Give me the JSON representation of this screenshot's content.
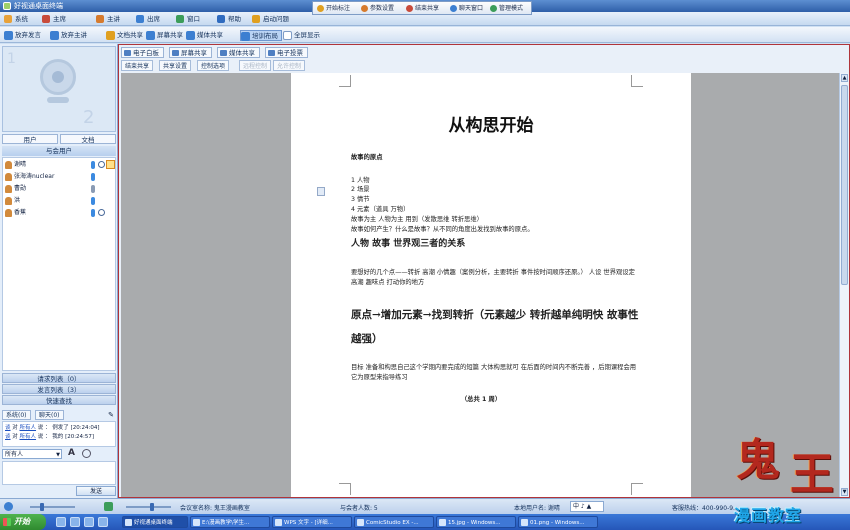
{
  "app": {
    "title": "好视通桌面终端"
  },
  "menu": [
    {
      "label": "系统",
      "color": "#e8a23a"
    },
    {
      "label": "主席",
      "color": "#c84b3b"
    },
    {
      "label": "主讲",
      "color": "#d67b2e"
    },
    {
      "label": "出席",
      "color": "#3c7fd1"
    },
    {
      "label": "窗口",
      "color": "#3c9d5a"
    },
    {
      "label": "帮助",
      "color": "#2f6bbf"
    },
    {
      "label": "启动问题",
      "color": "#e0a020"
    }
  ],
  "floatbar": [
    {
      "label": "开始标注",
      "color": "#e0a020"
    },
    {
      "label": "参数设置",
      "color": "#d67b2e"
    },
    {
      "label": "结束共享",
      "color": "#c84b3b"
    },
    {
      "label": "聊天窗口",
      "color": "#3c7fd1"
    },
    {
      "label": "管理模式",
      "color": "#3c9d5a"
    }
  ],
  "toolbar": [
    {
      "label": "放弃发言",
      "color": "#3c7fd1"
    },
    {
      "label": "放弃主讲",
      "color": "#3c7fd1"
    },
    {
      "label": "文档共享",
      "color": "#e0a020"
    },
    {
      "label": "屏幕共享",
      "color": "#3c7fd1"
    },
    {
      "label": "媒体共享",
      "color": "#3c7fd1"
    },
    {
      "label": "培训布局",
      "color": "#3c7fd1",
      "active": true
    },
    {
      "label": "全屏显示",
      "color": "#ffffff"
    }
  ],
  "left": {
    "tabs": [
      "用户",
      "文档"
    ],
    "section": "与会用户",
    "users": [
      "谢晴",
      "张海涛nuclear",
      "曹勋",
      "洪",
      "香蕉"
    ],
    "requests": "请求列表（0）",
    "speakers": "发言列表（3）",
    "search": "快速查找",
    "chat_tabs": [
      "系统(0)",
      "聊天(0)"
    ],
    "chat": [
      {
        "who": "谈",
        "to": "所有人",
        "says": "说",
        "msg": "例发了",
        "time": "[20:24:04]"
      },
      {
        "who": "谈",
        "to": "所有人",
        "says": "说",
        "msg": "我的",
        "time": "[20:24:57]"
      }
    ],
    "recipient": "所有人",
    "send": "发送"
  },
  "main": {
    "tabs": [
      "电子白板",
      "屏幕共享",
      "媒体共享",
      "电子投票"
    ],
    "sub_tools": [
      "结束共享",
      "共享设置",
      "控制选项"
    ],
    "sub_tools_disabled": [
      "远程控制",
      "允许控制"
    ]
  },
  "document": {
    "title": "从构思开始",
    "heading1": "故事的原点",
    "list": [
      "1 人物",
      "2 场景",
      "3 情节"
    ],
    "line4": "4 元素（道具 万物）",
    "line5": "故事为主 人物为主 用到（发散思维 转折思维）",
    "line6": "故事如何产生？什么是故事？从不同的角度出发找到故事的原点。",
    "heading2": "人物   故事   世界观三者的关系",
    "para1": "要想好的几个点——转折 高潮 小情趣（案例分析，主要转折 事件按时间顺序还原。） 人设  世界观设定  高潮  趣味点  打动你的地方",
    "heading3": "原点→增加元素→找到转折（元素越少 转折越单纯明快 故事性越强）",
    "para2": "目标 准备和构思自己这个学期内要完成的短篇   大体构思就可  在后面的时间内不断完善 ，后期课程会用它为原型来指导练习",
    "total": "（总共 1 周）"
  },
  "status": {
    "meeting": "会议室名称: 鬼王漫画教室",
    "attendees": "与会者人数: 5",
    "local_user": "本地用户名: 谢晴",
    "ime": "中 ♪ ▲",
    "hotline": "客服热线：400-990-9..."
  },
  "taskbar": {
    "start": "开始",
    "tasks": [
      "好视通桌面终端",
      "E:\\漫画教学\\学生...",
      "WPS 文字 - [详细...",
      "ComicStudio EX -...",
      "15.jpg - Windows...",
      "01.png - Windows..."
    ]
  },
  "watermark": {
    "glyphs": [
      "鬼",
      "王"
    ],
    "text": "漫画教室"
  }
}
